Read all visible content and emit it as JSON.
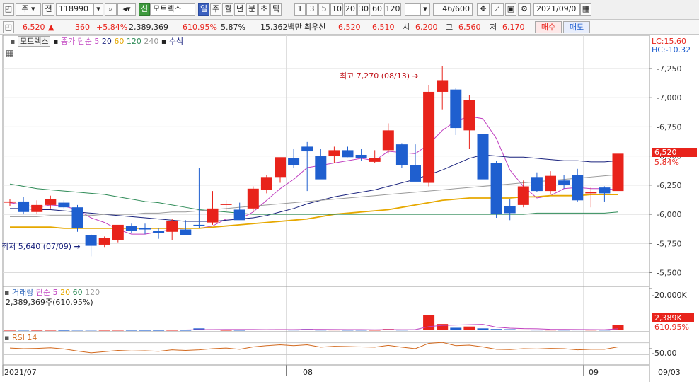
{
  "toolbar": {
    "period_type": "주",
    "prev_label": "전",
    "stock_code": "118990",
    "new_badge": "신",
    "stock_name": "모트렉스",
    "periods": [
      "일",
      "주",
      "월",
      "년",
      "분",
      "초",
      "틱"
    ],
    "selected_period": "일",
    "intervals": [
      "1",
      "3",
      "5",
      "10",
      "20",
      "30",
      "60",
      "120"
    ],
    "count": "46/600",
    "date": "2021/09/03"
  },
  "quote": {
    "price": "6,520",
    "change": "360",
    "change_pct": "+5.84%",
    "volume": "2,389,369",
    "volume_ratio": "610.95%",
    "turnover": "5.87%",
    "amount": "15,362백만",
    "best_ask_label": "최우선",
    "best_ask": "6,520",
    "best_bid": "6,510",
    "open_label": "시",
    "open": "6,200",
    "high_label": "고",
    "high": "6,560",
    "low_label": "저",
    "low": "6,170",
    "buy_label": "매수",
    "sell_label": "매도"
  },
  "legend": {
    "name": "모트렉스",
    "ma_prefix": "종가 단순",
    "ma_periods": [
      "5",
      "20",
      "60",
      "120",
      "240"
    ],
    "suffix": "수식",
    "lc": "LC:15.60",
    "hc": "HC:-10.32",
    "high_note": "최고 7,270 (08/13)",
    "low_note": "최저 5,640 (07/09)",
    "price_tag": "6,520",
    "pct_tag": "5.84%"
  },
  "volume_panel": {
    "title": "거래량",
    "ma_prefix": "단순",
    "ma_periods": [
      "5",
      "20",
      "60",
      "120"
    ],
    "value_text": "2,389,369주(610.95%)",
    "axis_label": "20,000K",
    "vol_tag": "2,389K",
    "pct_tag": "610.95%"
  },
  "rsi_panel": {
    "title": "RSI 14",
    "axis_label": "50,00"
  },
  "x_axis": {
    "labels": [
      "2021/07",
      "08",
      "09"
    ],
    "right_date": "09/03"
  },
  "colors": {
    "up": "#e8231b",
    "down": "#1f5fcf",
    "ma5": "#c040c0",
    "ma20": "#1a237e",
    "ma60": "#e6a800",
    "ma120": "#2e8b57",
    "ma240": "#9a9a9a",
    "volume_ma5": "#c040c0",
    "rsi": "#d2691e"
  },
  "chart_data": {
    "type": "candlestick",
    "dates": [
      "07/01",
      "07/02",
      "07/05",
      "07/06",
      "07/07",
      "07/08",
      "07/09",
      "07/12",
      "07/13",
      "07/14",
      "07/15",
      "07/16",
      "07/19",
      "07/20",
      "07/21",
      "07/22",
      "07/23",
      "07/26",
      "07/27",
      "07/28",
      "07/29",
      "07/30",
      "08/02",
      "08/03",
      "08/04",
      "08/05",
      "08/06",
      "08/09",
      "08/10",
      "08/11",
      "08/12",
      "08/13",
      "08/17",
      "08/18",
      "08/19",
      "08/20",
      "08/23",
      "08/24",
      "08/25",
      "08/26",
      "08/27",
      "08/30",
      "08/31",
      "09/01",
      "09/02",
      "09/03"
    ],
    "ohlc": [
      [
        6100,
        6130,
        6070,
        6110
      ],
      [
        6110,
        6150,
        6000,
        6020
      ],
      [
        6020,
        6120,
        6000,
        6080
      ],
      [
        6080,
        6160,
        6050,
        6130
      ],
      [
        6100,
        6120,
        6050,
        6060
      ],
      [
        6060,
        6080,
        5850,
        5880
      ],
      [
        5820,
        5830,
        5640,
        5730
      ],
      [
        5740,
        5810,
        5720,
        5800
      ],
      [
        5780,
        5900,
        5760,
        5910
      ],
      [
        5900,
        5920,
        5840,
        5860
      ],
      [
        5880,
        5920,
        5830,
        5870
      ],
      [
        5860,
        5880,
        5790,
        5840
      ],
      [
        5850,
        5960,
        5780,
        5940
      ],
      [
        5870,
        5950,
        5830,
        5820
      ],
      [
        5910,
        6400,
        5880,
        5900
      ],
      [
        5930,
        6200,
        5910,
        6050
      ],
      [
        6080,
        6120,
        6030,
        6090
      ],
      [
        6040,
        6100,
        5980,
        5950
      ],
      [
        6050,
        6240,
        6020,
        6220
      ],
      [
        6210,
        6340,
        6180,
        6320
      ],
      [
        6320,
        6480,
        6270,
        6490
      ],
      [
        6480,
        6560,
        6400,
        6420
      ],
      [
        6580,
        6620,
        6200,
        6540
      ],
      [
        6500,
        6560,
        6380,
        6300
      ],
      [
        6500,
        6580,
        6440,
        6550
      ],
      [
        6550,
        6580,
        6490,
        6490
      ],
      [
        6510,
        6560,
        6460,
        6480
      ],
      [
        6450,
        6550,
        6440,
        6480
      ],
      [
        6550,
        6780,
        6520,
        6720
      ],
      [
        6600,
        6610,
        6400,
        6420
      ],
      [
        6420,
        6600,
        6290,
        6280
      ],
      [
        6270,
        7110,
        6240,
        7050
      ],
      [
        7050,
        7270,
        6900,
        7150
      ],
      [
        7070,
        7080,
        6680,
        6740
      ],
      [
        6720,
        7020,
        6560,
        6980
      ],
      [
        6690,
        6740,
        6300,
        6300
      ],
      [
        6440,
        6460,
        5970,
        6000
      ],
      [
        6070,
        6130,
        5950,
        6010
      ],
      [
        6080,
        6290,
        6060,
        6240
      ],
      [
        6320,
        6360,
        6190,
        6200
      ],
      [
        6200,
        6370,
        6170,
        6330
      ],
      [
        6290,
        6340,
        6220,
        6250
      ],
      [
        6340,
        6390,
        6110,
        6120
      ],
      [
        6180,
        6230,
        6060,
        6190
      ],
      [
        6230,
        6240,
        6110,
        6180
      ],
      [
        6200,
        6560,
        6170,
        6520
      ]
    ],
    "ma": {
      "5": [
        6100,
        6080,
        6060,
        6080,
        6070,
        6040,
        5970,
        5930,
        5870,
        5830,
        5830,
        5850,
        5870,
        5880,
        5880,
        5900,
        5960,
        5960,
        6020,
        6120,
        6220,
        6300,
        6400,
        6420,
        6440,
        6460,
        6480,
        6460,
        6540,
        6530,
        6520,
        6600,
        6720,
        6800,
        6840,
        6820,
        6650,
        6380,
        6240,
        6140,
        6160,
        6220,
        6230,
        6220,
        6220,
        6210
      ],
      "20": [
        6050,
        6050,
        6040,
        6040,
        6030,
        6020,
        6010,
        6000,
        5990,
        5980,
        5970,
        5960,
        5950,
        5940,
        5940,
        5940,
        5950,
        5960,
        5970,
        5990,
        6020,
        6050,
        6090,
        6120,
        6150,
        6170,
        6190,
        6210,
        6240,
        6270,
        6300,
        6340,
        6380,
        6430,
        6480,
        6510,
        6500,
        6490,
        6490,
        6480,
        6470,
        6460,
        6460,
        6450,
        6450,
        6460
      ],
      "60": [
        5890,
        5890,
        5890,
        5890,
        5880,
        5880,
        5880,
        5880,
        5880,
        5880,
        5880,
        5880,
        5880,
        5880,
        5880,
        5890,
        5900,
        5910,
        5920,
        5930,
        5940,
        5950,
        5960,
        5980,
        6000,
        6010,
        6020,
        6030,
        6040,
        6060,
        6080,
        6100,
        6120,
        6130,
        6140,
        6140,
        6140,
        6140,
        6150,
        6150,
        6160,
        6160,
        6160,
        6170,
        6170,
        6170
      ],
      "120": [
        6260,
        6240,
        6220,
        6210,
        6200,
        6190,
        6180,
        6170,
        6150,
        6130,
        6110,
        6100,
        6080,
        6060,
        6040,
        6030,
        6020,
        6010,
        6000,
        6000,
        6000,
        6000,
        6000,
        6000,
        6000,
        6000,
        6000,
        6000,
        6000,
        6000,
        6000,
        6000,
        6000,
        6000,
        6000,
        6000,
        6000,
        6000,
        6000,
        6010,
        6010,
        6010,
        6010,
        6010,
        6010,
        6020
      ],
      "240": [
        5980,
        5980,
        5980,
        5990,
        5990,
        5990,
        5990,
        6000,
        6000,
        6000,
        6010,
        6010,
        6020,
        6020,
        6030,
        6040,
        6050,
        6060,
        6070,
        6080,
        6090,
        6100,
        6110,
        6120,
        6130,
        6140,
        6150,
        6160,
        6170,
        6180,
        6190,
        6200,
        6210,
        6220,
        6230,
        6240,
        6250,
        6260,
        6270,
        6280,
        6290,
        6300,
        6310,
        6320,
        6330,
        6340
      ]
    },
    "volume_k": [
      150,
      180,
      130,
      160,
      120,
      200,
      220,
      160,
      180,
      150,
      140,
      130,
      170,
      150,
      900,
      420,
      160,
      180,
      420,
      380,
      520,
      280,
      600,
      260,
      300,
      220,
      220,
      200,
      620,
      260,
      380,
      7300,
      3000,
      1200,
      1800,
      900,
      600,
      500,
      350,
      300,
      280,
      250,
      320,
      260,
      240,
      2389
    ],
    "volume_ma5_k": [
      160,
      160,
      150,
      150,
      150,
      160,
      170,
      180,
      180,
      180,
      170,
      150,
      150,
      150,
      300,
      360,
      370,
      380,
      380,
      310,
      350,
      360,
      440,
      410,
      400,
      340,
      330,
      260,
      330,
      310,
      340,
      1760,
      2320,
      2480,
      2660,
      2840,
      1500,
      1000,
      790,
      730,
      470,
      420,
      390,
      340,
      310,
      700
    ],
    "rsi": [
      52,
      50,
      51,
      53,
      49,
      42,
      36,
      40,
      44,
      42,
      43,
      41,
      46,
      44,
      46,
      50,
      52,
      48,
      56,
      60,
      63,
      60,
      63,
      55,
      58,
      57,
      56,
      55,
      61,
      55,
      50,
      68,
      71,
      60,
      62,
      56,
      48,
      47,
      50,
      49,
      51,
      50,
      46,
      48,
      48,
      56
    ],
    "ylim": [
      5400,
      7450
    ],
    "yticks": [
      5500,
      5750,
      6000,
      6250,
      6500,
      6750,
      7000,
      7250
    ],
    "volume_ylim_k": [
      0,
      20000
    ],
    "rsi_ylim": [
      0,
      100
    ]
  }
}
